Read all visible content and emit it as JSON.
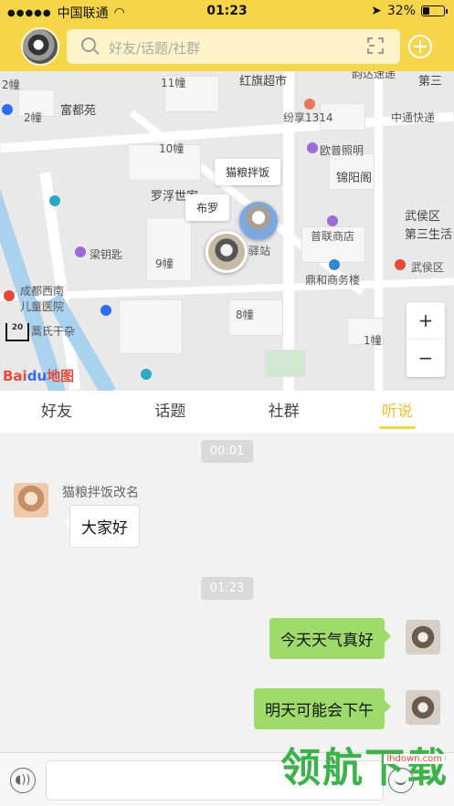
{
  "status_bar": {
    "carrier": "中国联通",
    "time": "01:23",
    "battery": "32%"
  },
  "header": {
    "search_placeholder": "好友/话题/社群"
  },
  "map": {
    "labels": {
      "hongqi": "红旗超市",
      "yunda": "韵达速递",
      "fudu": "富都苑",
      "fenxiang": "纷享1314",
      "zhongtong": "中通快递",
      "oupu": "欧普照明",
      "jinyang": "锦阳阁",
      "luofu": "罗浮世家",
      "wuhou1": "武侯区",
      "sanshengjie": "第三生活",
      "puliang": "普联商店",
      "liangyao": "梁钥匙",
      "dinghe": "鼎和商务楼",
      "wuhou2": "武侯区",
      "hospital": "成都西南\n儿童医院",
      "shi": "蒿氏干杂",
      "yizhan": "驿站",
      "num2_1": "2幢",
      "num2_2": "2幢",
      "num10": "10幢",
      "num11": "11幢",
      "num9": "9幢",
      "num8": "8幢",
      "num1": "1幢",
      "sanqi": "第三"
    },
    "bubble_1": "猫粮拌饭",
    "bubble_2": "布罗",
    "zoom_in": "+",
    "zoom_out": "−",
    "scale_label": "20",
    "logo_bai": "Bai",
    "logo_du": "du",
    "logo_map": "地图"
  },
  "tabs": [
    {
      "label": "好友",
      "active": false
    },
    {
      "label": "话题",
      "active": false
    },
    {
      "label": "社群",
      "active": false
    },
    {
      "label": "听说",
      "active": true
    }
  ],
  "chat": {
    "time_1": "00:01",
    "sender_1": "猫粮拌饭改名",
    "message_1": "大家好",
    "time_2": "01:23",
    "message_2": "今天天气真好",
    "message_3": "明天可能会下午"
  },
  "watermark": {
    "text": "领航下载",
    "url": "lhdown.com"
  },
  "colors": {
    "brand_yellow": "#f7d54a",
    "outgoing_bubble": "#9fdb6b",
    "active_tab": "#f2c12e"
  }
}
